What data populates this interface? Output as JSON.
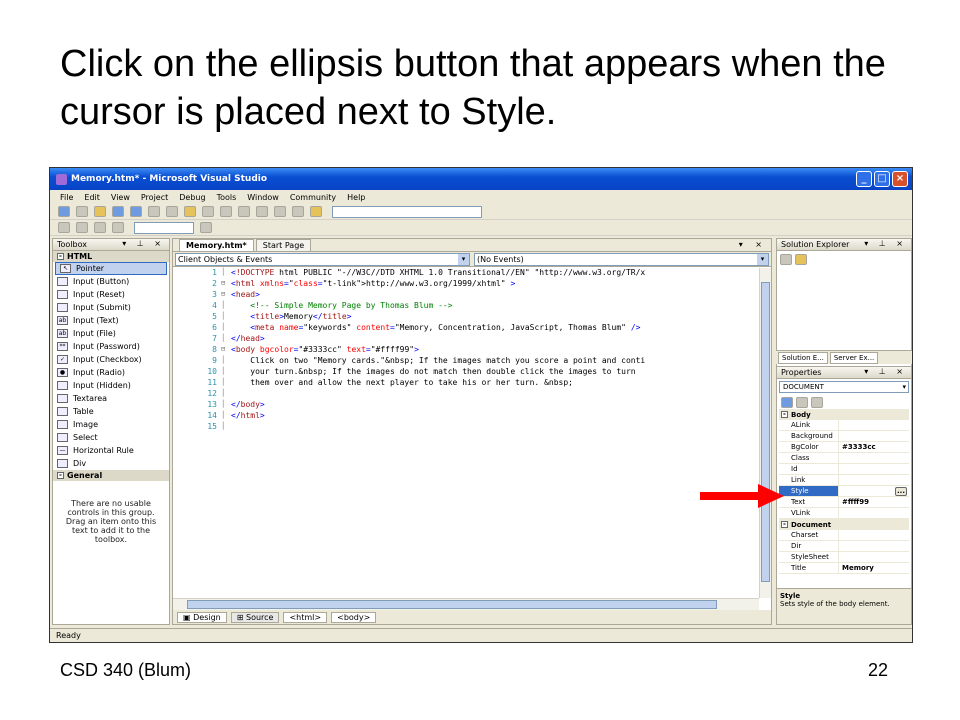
{
  "slide": {
    "title": "Click on the ellipsis button that appears when the cursor is placed next to Style.",
    "footer_left": "CSD 340 (Blum)",
    "footer_right": "22"
  },
  "window": {
    "title": "Memory.htm* - Microsoft Visual Studio",
    "minimize_glyph": "_",
    "maximize_glyph": "□",
    "close_glyph": "×"
  },
  "menu": [
    "File",
    "Edit",
    "View",
    "Project",
    "Debug",
    "Tools",
    "Window",
    "Community",
    "Help"
  ],
  "toolbox": {
    "title": "Toolbox",
    "controls": "▾ ⊥ ×",
    "html_group": "HTML",
    "items": [
      "Pointer",
      "Input (Button)",
      "Input (Reset)",
      "Input (Submit)",
      "Input (Text)",
      "Input (File)",
      "Input (Password)",
      "Input (Checkbox)",
      "Input (Radio)",
      "Input (Hidden)",
      "Textarea",
      "Table",
      "Image",
      "Select",
      "Horizontal Rule",
      "Div"
    ],
    "general_group": "General",
    "empty_text": "There are no usable controls in this group. Drag an item onto this text to add it to the toolbox."
  },
  "editor": {
    "tabs": [
      "Memory.htm*",
      "Start Page"
    ],
    "tab_controls": "▾ ×",
    "object_combo": "Client Objects & Events",
    "event_combo": "(No Events)",
    "line_numbers": [
      "1",
      "2",
      "3",
      "4",
      "5",
      "6",
      "7",
      "8",
      "9",
      "10",
      "11",
      "12",
      "13",
      "14",
      "15"
    ],
    "lines": [
      "<!DOCTYPE html PUBLIC \"-//W3C//DTD XHTML 1.0 Transitional//EN\" \"http://www.w3.org/TR/x",
      "<html xmlns=\"http://www.w3.org/1999/xhtml\" >",
      "<head>",
      "    <!-- Simple Memory Page by Thomas Blum -->",
      "    <title>Memory</title>",
      "    <meta name=\"keywords\" content=\"Memory, Concentration, JavaScript, Thomas Blum\" />",
      "</head>",
      "<body bgcolor=\"#3333cc\" text=\"#ffff99\">",
      "    Click on two \"Memory cards.\"&nbsp; If the images match you score a point and conti",
      "    your turn.&nbsp; If the images do not match then double click the images to turn",
      "    them over and allow the next player to take his or her turn. &nbsp;",
      "",
      "</body>",
      "</html>",
      ""
    ],
    "design_label": "Design",
    "source_label": "Source",
    "crumb_html": "<html>",
    "crumb_body": "<body>"
  },
  "solution_explorer": {
    "title": "Solution Explorer",
    "controls": "▾ ⊥ ×",
    "tab1": "Solution E...",
    "tab2": "Server Ex..."
  },
  "properties": {
    "title": "Properties",
    "controls": "▾ ⊥ ×",
    "object": "DOCUMENT",
    "cat_body": "Body",
    "rows_body": [
      {
        "name": "ALink",
        "value": ""
      },
      {
        "name": "Background",
        "value": ""
      },
      {
        "name": "BgColor",
        "value": "#3333cc"
      },
      {
        "name": "Class",
        "value": ""
      },
      {
        "name": "Id",
        "value": ""
      },
      {
        "name": "Link",
        "value": ""
      },
      {
        "name": "Style",
        "value": ""
      },
      {
        "name": "Text",
        "value": "#ffff99"
      },
      {
        "name": "VLink",
        "value": ""
      }
    ],
    "cat_document": "Document",
    "rows_document": [
      {
        "name": "Charset",
        "value": ""
      },
      {
        "name": "Dir",
        "value": ""
      },
      {
        "name": "StyleSheet",
        "value": ""
      },
      {
        "name": "Title",
        "value": "Memory"
      }
    ],
    "ellipsis": "...",
    "desc_title": "Style",
    "desc_text": "Sets style of the body element."
  },
  "status": "Ready",
  "colors": {
    "arrow": "#ff0000",
    "titlebar": "#0a4fd3"
  }
}
